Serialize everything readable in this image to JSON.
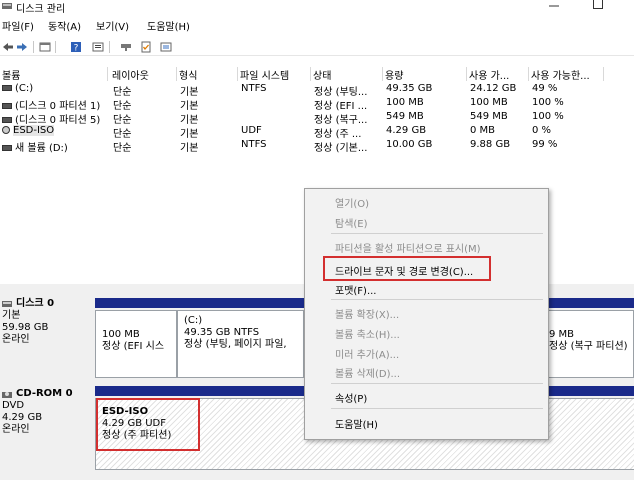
{
  "window": {
    "title": "디스크 관리"
  },
  "menu": [
    "파일(F)",
    "동작(A)",
    "보기(V)",
    "도움말(H)"
  ],
  "columns": [
    "볼륨",
    "레이아웃",
    "형식",
    "파일 시스템",
    "상태",
    "용량",
    "사용 가...",
    "사용 가능한..."
  ],
  "volumes": [
    {
      "name": "(C:)",
      "layout": "단순",
      "type": "기본",
      "fs": "NTFS",
      "status": "정상 (부팅...",
      "capacity": "49.35 GB",
      "free": "24.12 GB",
      "pct": "49 %"
    },
    {
      "name": "(디스크 0 파티션 1)",
      "layout": "단순",
      "type": "기본",
      "fs": "",
      "status": "정상 (EFI ...",
      "capacity": "100 MB",
      "free": "100 MB",
      "pct": "100 %"
    },
    {
      "name": "(디스크 0 파티션 5)",
      "layout": "단순",
      "type": "기본",
      "fs": "",
      "status": "정상 (복구...",
      "capacity": "549 MB",
      "free": "549 MB",
      "pct": "100 %"
    },
    {
      "name": "ESD-ISO",
      "layout": "단순",
      "type": "기본",
      "fs": "UDF",
      "status": "정상 (주 ...",
      "capacity": "4.29 GB",
      "free": "0 MB",
      "pct": "0 %"
    },
    {
      "name": "새 볼륨 (D:)",
      "layout": "단순",
      "type": "기본",
      "fs": "NTFS",
      "status": "정상 (기본...",
      "capacity": "10.00 GB",
      "free": "9.88 GB",
      "pct": "99 %"
    }
  ],
  "disk0": {
    "name": "디스크 0",
    "type": "기본",
    "size": "59.98 GB",
    "state": "온라인",
    "p1": {
      "size": "100 MB",
      "status": "정상 (EFI 시스"
    },
    "p2": {
      "label": "(C:)",
      "size": "49.35 GB NTFS",
      "status": "정상 (부팅, 페이지 파일,"
    },
    "p3": {
      "size": "9 MB",
      "status": "정상 (복구 파티션)"
    }
  },
  "cdrom0": {
    "name": "CD-ROM 0",
    "type": "DVD",
    "size": "4.29 GB",
    "state": "온라인",
    "part": {
      "label": "ESD-ISO",
      "size": "4.29 GB UDF",
      "status": "정상 (주 파티션)"
    }
  },
  "context_menu": {
    "open": "열기(O)",
    "explore": "탐색(E)",
    "mark_active": "파티션을 활성 파티션으로 표시(M)",
    "change_letter": "드라이브 문자 및 경로 변경(C)...",
    "format": "포맷(F)...",
    "extend": "볼륨 확장(X)...",
    "shrink": "볼륨 축소(H)...",
    "add_mirror": "미러 추가(A)...",
    "delete": "볼륨 삭제(D)...",
    "properties": "속성(P)",
    "help": "도움말(H)"
  },
  "colors": {
    "partition_bar": "#1a2a8a",
    "highlight": "#d32f2f"
  }
}
